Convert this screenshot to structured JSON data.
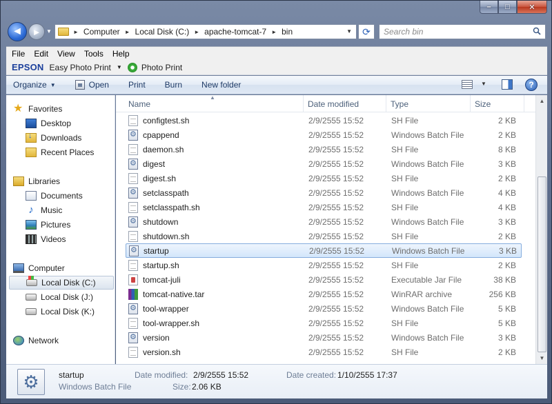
{
  "window": {
    "minimize": "–",
    "maximize": "□",
    "close": "✕"
  },
  "nav": {
    "back": "◄",
    "forward": "►"
  },
  "address": {
    "crumbs": [
      "Computer",
      "Local Disk (C:)",
      "apache-tomcat-7",
      "bin"
    ]
  },
  "search": {
    "placeholder": "Search bin"
  },
  "menu": {
    "items": [
      "File",
      "Edit",
      "View",
      "Tools",
      "Help"
    ]
  },
  "epson": {
    "logo": "EPSON",
    "easy_photo_print": "Easy Photo Print",
    "photo_print": "Photo Print"
  },
  "commands": {
    "organize": "Organize",
    "open": "Open",
    "print": "Print",
    "burn": "Burn",
    "new_folder": "New folder"
  },
  "sidebar": {
    "favorites": "Favorites",
    "desktop": "Desktop",
    "downloads": "Downloads",
    "recent_places": "Recent Places",
    "libraries": "Libraries",
    "documents": "Documents",
    "music": "Music",
    "pictures": "Pictures",
    "videos": "Videos",
    "computer": "Computer",
    "local_disk_c": "Local Disk (C:)",
    "local_disk_j": "Local Disk (J:)",
    "local_disk_k": "Local Disk (K:)",
    "network": "Network"
  },
  "columns": {
    "name": "Name",
    "date_modified": "Date modified",
    "type": "Type",
    "size": "Size"
  },
  "files": [
    {
      "name": "configtest.sh",
      "date": "2/9/2555 15:52",
      "type": "SH File",
      "size": "2 KB",
      "icon": "sh"
    },
    {
      "name": "cpappend",
      "date": "2/9/2555 15:52",
      "type": "Windows Batch File",
      "size": "2 KB",
      "icon": "bat"
    },
    {
      "name": "daemon.sh",
      "date": "2/9/2555 15:52",
      "type": "SH File",
      "size": "8 KB",
      "icon": "sh"
    },
    {
      "name": "digest",
      "date": "2/9/2555 15:52",
      "type": "Windows Batch File",
      "size": "3 KB",
      "icon": "bat"
    },
    {
      "name": "digest.sh",
      "date": "2/9/2555 15:52",
      "type": "SH File",
      "size": "2 KB",
      "icon": "sh"
    },
    {
      "name": "setclasspath",
      "date": "2/9/2555 15:52",
      "type": "Windows Batch File",
      "size": "4 KB",
      "icon": "bat"
    },
    {
      "name": "setclasspath.sh",
      "date": "2/9/2555 15:52",
      "type": "SH File",
      "size": "4 KB",
      "icon": "sh"
    },
    {
      "name": "shutdown",
      "date": "2/9/2555 15:52",
      "type": "Windows Batch File",
      "size": "3 KB",
      "icon": "bat"
    },
    {
      "name": "shutdown.sh",
      "date": "2/9/2555 15:52",
      "type": "SH File",
      "size": "2 KB",
      "icon": "sh"
    },
    {
      "name": "startup",
      "date": "2/9/2555 15:52",
      "type": "Windows Batch File",
      "size": "3 KB",
      "icon": "bat",
      "selected": true
    },
    {
      "name": "startup.sh",
      "date": "2/9/2555 15:52",
      "type": "SH File",
      "size": "2 KB",
      "icon": "sh"
    },
    {
      "name": "tomcat-juli",
      "date": "2/9/2555 15:52",
      "type": "Executable Jar File",
      "size": "38 KB",
      "icon": "jar"
    },
    {
      "name": "tomcat-native.tar",
      "date": "2/9/2555 15:52",
      "type": "WinRAR archive",
      "size": "256 KB",
      "icon": "rar"
    },
    {
      "name": "tool-wrapper",
      "date": "2/9/2555 15:52",
      "type": "Windows Batch File",
      "size": "5 KB",
      "icon": "bat"
    },
    {
      "name": "tool-wrapper.sh",
      "date": "2/9/2555 15:52",
      "type": "SH File",
      "size": "5 KB",
      "icon": "sh"
    },
    {
      "name": "version",
      "date": "2/9/2555 15:52",
      "type": "Windows Batch File",
      "size": "3 KB",
      "icon": "bat"
    },
    {
      "name": "version.sh",
      "date": "2/9/2555 15:52",
      "type": "SH File",
      "size": "2 KB",
      "icon": "sh"
    }
  ],
  "details": {
    "name": "startup",
    "type": "Windows Batch File",
    "date_modified_label": "Date modified:",
    "date_modified": "2/9/2555 15:52",
    "size_label": "Size:",
    "size": "2.06 KB",
    "date_created_label": "Date created:",
    "date_created": "1/10/2555 17:37"
  }
}
